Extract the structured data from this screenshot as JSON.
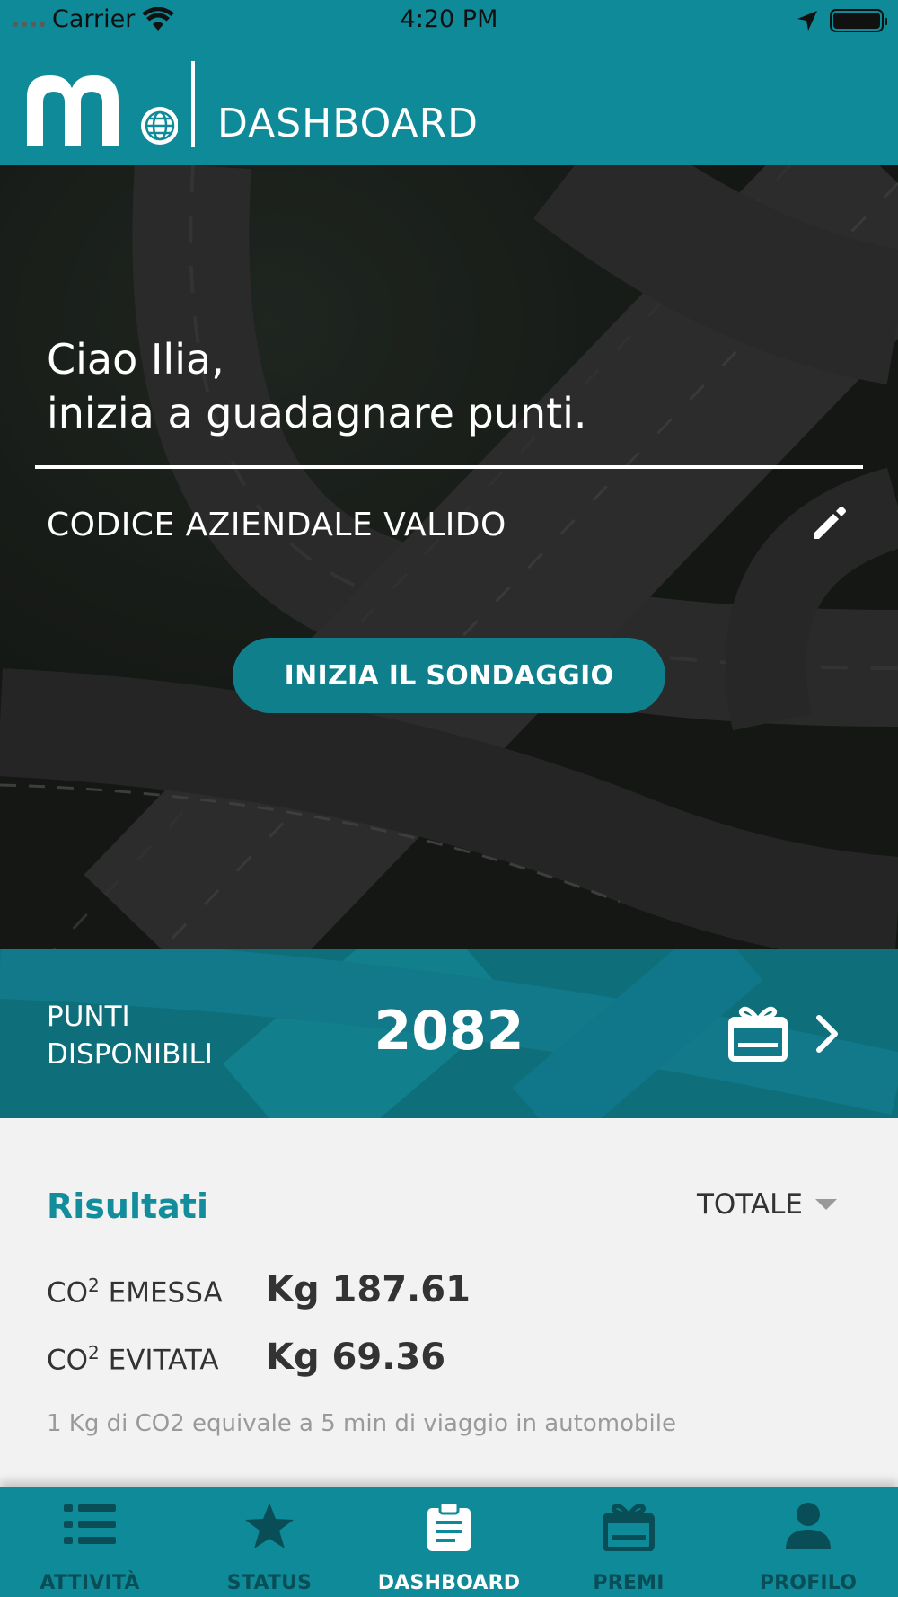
{
  "status_bar": {
    "carrier": "Carrier",
    "time": "4:20 PM"
  },
  "header": {
    "title": "DASHBOARD",
    "logo_icon": "m-globe-logo"
  },
  "hero": {
    "greeting_line1": "Ciao Ilia,",
    "greeting_line2": "inizia a guadagnare punti.",
    "company_code_status": "CODICE AZIENDALE VALIDO",
    "edit_icon": "pencil-icon",
    "survey_button": "INIZIA IL SONDAGGIO"
  },
  "points": {
    "label_line1": "PUNTI",
    "label_line2": "DISPONIBILI",
    "value": "2082",
    "icon": "gift-card-icon"
  },
  "results": {
    "title": "Risultati",
    "period": "TOTALE",
    "co2_emitted": {
      "label_prefix": "CO",
      "label_sup": "2",
      "label_suffix": " EMESSA",
      "value": "Kg 187.61"
    },
    "co2_avoided": {
      "label_prefix": "CO",
      "label_sup": "2",
      "label_suffix": " EVITATA",
      "value": "Kg 69.36"
    },
    "footnote": "1 Kg di CO2 equivale a 5 min di viaggio in automobile"
  },
  "tabs": [
    {
      "label": "ATTIVITÀ",
      "icon": "list-icon",
      "active": false
    },
    {
      "label": "STATUS",
      "icon": "star-icon",
      "active": false
    },
    {
      "label": "DASHBOARD",
      "icon": "clipboard-icon",
      "active": true
    },
    {
      "label": "PREMI",
      "icon": "gift-icon",
      "active": false
    },
    {
      "label": "PROFILO",
      "icon": "person-icon",
      "active": false
    }
  ],
  "colors": {
    "brand_teal": "#0f8a98",
    "button_teal": "#0f7f8c",
    "title_teal": "#138d9c"
  }
}
